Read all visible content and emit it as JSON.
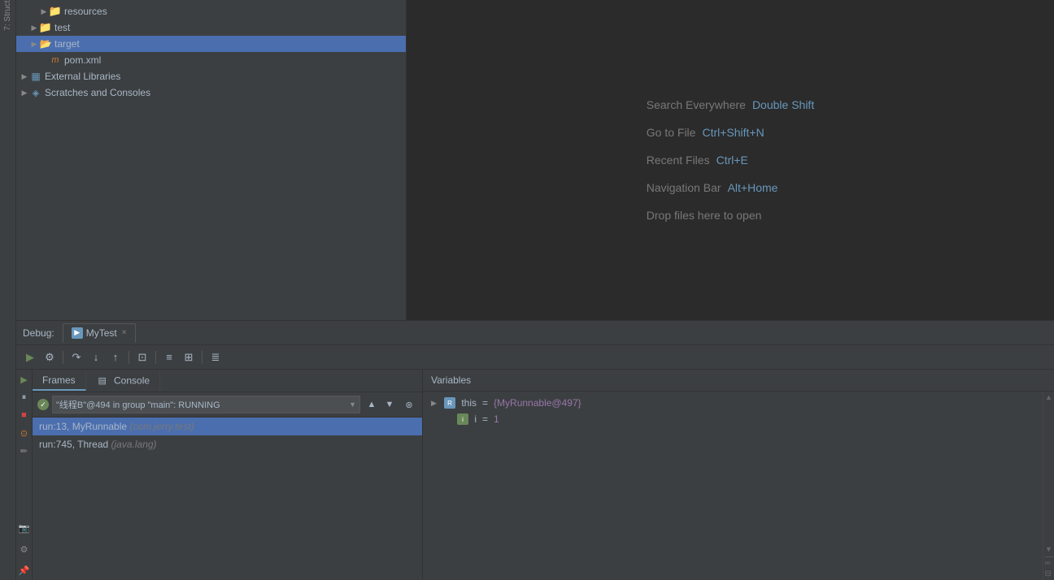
{
  "sidebar": {
    "items": [
      {
        "label": "resources",
        "type": "folder",
        "indent": 2,
        "expanded": false
      },
      {
        "label": "test",
        "type": "folder",
        "indent": 1,
        "expanded": false
      },
      {
        "label": "target",
        "type": "folder",
        "indent": 1,
        "expanded": true,
        "selected": true
      },
      {
        "label": "pom.xml",
        "type": "xml",
        "indent": 2
      },
      {
        "label": "External Libraries",
        "type": "extlib",
        "indent": 0,
        "expanded": false
      },
      {
        "label": "Scratches and Consoles",
        "type": "scratches",
        "indent": 0,
        "expanded": false
      }
    ]
  },
  "editor": {
    "hints": [
      {
        "label": "Search Everywhere",
        "shortcut": "Double Shift"
      },
      {
        "label": "Go to File",
        "shortcut": "Ctrl+Shift+N"
      },
      {
        "label": "Recent Files",
        "shortcut": "Ctrl+E"
      },
      {
        "label": "Navigation Bar",
        "shortcut": "Alt+Home"
      },
      {
        "label": "Drop files here to open",
        "shortcut": ""
      }
    ]
  },
  "debug": {
    "tab_label": "Debug:",
    "tab_name": "MyTest",
    "tab_close": "×",
    "toolbar_buttons": [
      "▶",
      "⚙",
      "↑",
      "↓",
      "↑",
      "⊡",
      "≡",
      "⊞",
      "≣"
    ],
    "sub_tabs": [
      {
        "label": "Frames",
        "active": true
      },
      {
        "label": "Console",
        "active": false
      }
    ],
    "thread": {
      "check": "✓",
      "name": "\"线程B\"@494 in group \"main\": RUNNING"
    },
    "frames": [
      {
        "label": "run:13, MyRunnable",
        "package": "(com.jerry.test)",
        "selected": true
      },
      {
        "label": "run:745, Thread",
        "package": "(java.lang)",
        "selected": false
      }
    ],
    "variables_label": "Variables",
    "variables": [
      {
        "name": "this",
        "equals": "=",
        "value": "{MyRunnable@497}",
        "type": "ref",
        "expanded": true
      },
      {
        "name": "i",
        "equals": "=",
        "value": "1",
        "type": "int",
        "expanded": false
      }
    ]
  },
  "colors": {
    "accent_blue": "#6897bb",
    "accent_green": "#6a8759",
    "accent_red": "#cc4444",
    "selected_bg": "#4b6eaf",
    "bg_dark": "#2b2b2b",
    "bg_medium": "#3c3f41",
    "text_main": "#a9b7c6",
    "text_dim": "#787878"
  }
}
